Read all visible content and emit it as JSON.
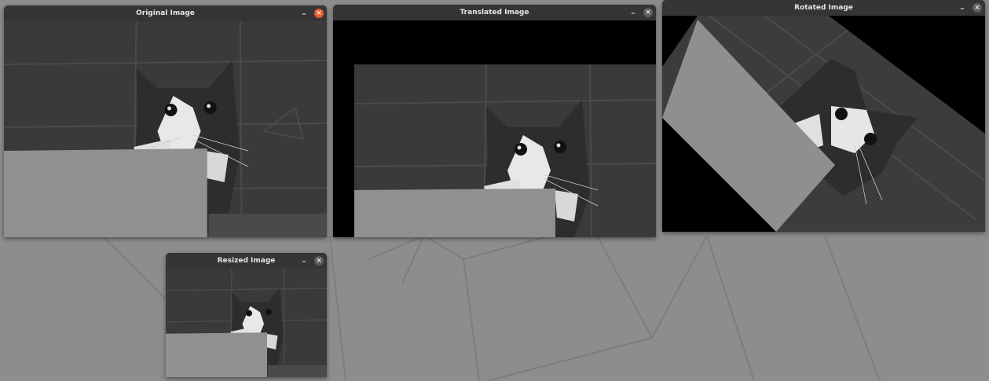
{
  "windows": [
    {
      "id": "original",
      "title": "Original Image",
      "active": true
    },
    {
      "id": "translated",
      "title": "Translated Image",
      "active": false
    },
    {
      "id": "rotated",
      "title": "Rotated Image",
      "active": false
    },
    {
      "id": "resized",
      "title": "Resized Image",
      "active": false
    }
  ],
  "controls": {
    "minimize_glyph": "–",
    "close_glyph": "×"
  },
  "colors": {
    "desktop": "#8c8c8c",
    "titlebar": "#353535",
    "close_active": "#e85a2c"
  }
}
